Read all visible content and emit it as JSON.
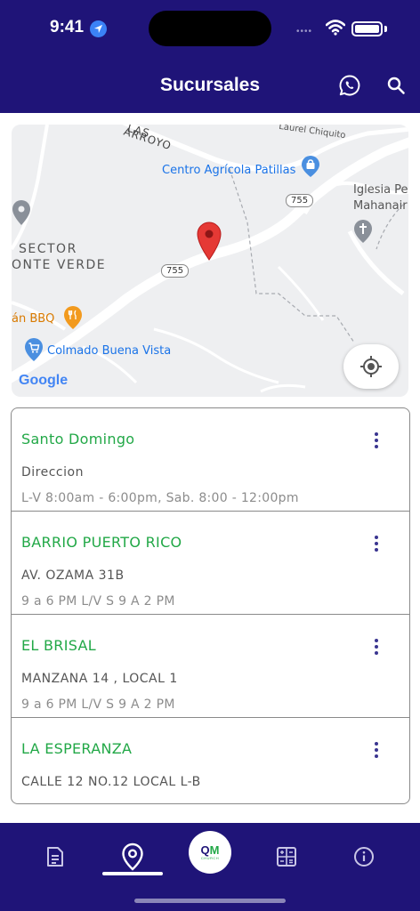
{
  "status_bar": {
    "time": "9:41",
    "signal": "••••"
  },
  "header": {
    "title": "Sucursales",
    "whatsapp_icon": "whatsapp-icon",
    "search_icon": "search-icon"
  },
  "map": {
    "labels": {
      "arroyo": "ARROYO",
      "las": "LAS",
      "laurel": "Laurel Chiquito",
      "centro": "Centro Agrícola Patillas",
      "iglesia": "Iglesia Pe",
      "mahanaim": "Mahanair",
      "sector": "SECTOR",
      "monte_verde": "ONTE VERDE",
      "road_755_a": "755",
      "road_755_b": "755",
      "bbq": "án BBQ",
      "colmado": "Colmado Buena Vista",
      "google": "Google"
    },
    "colors": {
      "road": "#ffffff",
      "land": "#eeeff1",
      "pin": "#e53935",
      "poi_blue": "#4a8fe0",
      "poi_orange": "#f29a1e"
    }
  },
  "branches": [
    {
      "name": "Santo Domingo",
      "address": "Direccion",
      "hours": "L-V 8:00am - 6:00pm, Sab. 8:00 - 12:00pm"
    },
    {
      "name": "BARRIO PUERTO RICO",
      "address": "AV. OZAMA 31B",
      "hours": "9 a 6 PM L/V  S 9 A 2 PM"
    },
    {
      "name": "EL BRISAL",
      "address": "MANZANA 14 , LOCAL 1",
      "hours": "9 a 6 PM L/V  S 9 A 2 PM"
    },
    {
      "name": "LA ESPERANZA",
      "address": "CALLE 12 NO.12 LOCAL L-B",
      "hours": ""
    }
  ],
  "bottom_nav": {
    "items": [
      "document-icon",
      "location-pin-icon",
      "qm-logo",
      "calculator-icon",
      "info-icon"
    ],
    "active": "location-pin-icon",
    "logo_text_q": "Q",
    "logo_text_m": "M",
    "logo_sub": "CHURCH"
  },
  "colors": {
    "primary": "#1f1478",
    "accent_green": "#22a847"
  }
}
